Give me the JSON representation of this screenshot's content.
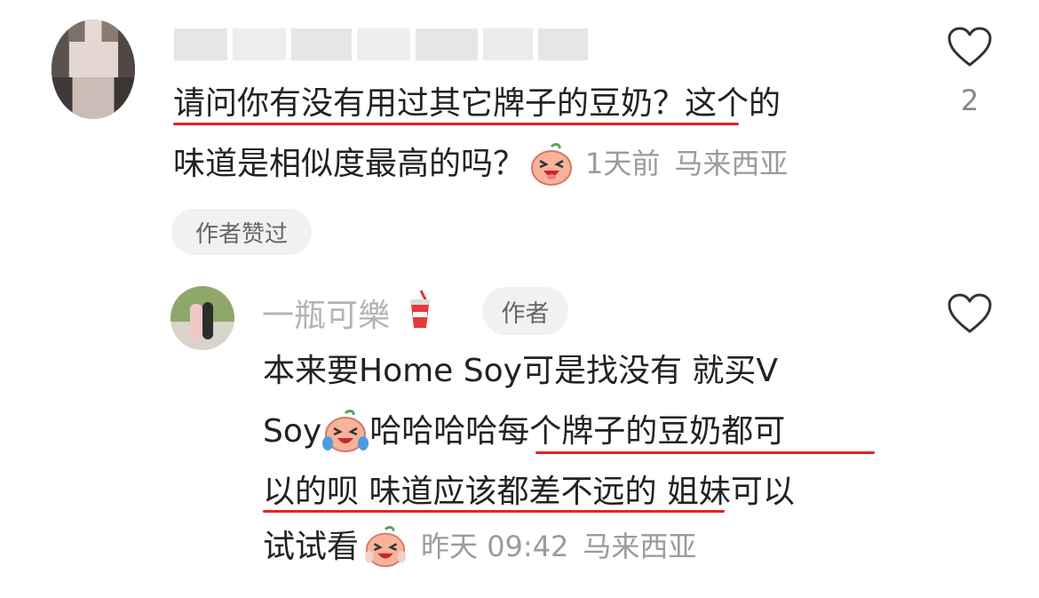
{
  "comment": {
    "text_line1": "请问你有没有用过其它牌子的豆奶？这个的",
    "text_line2": "味道是相似度最高的吗？",
    "time": "1天前",
    "location": "马来西亚",
    "like_count": "2",
    "liked_badge": "作者赞过"
  },
  "reply": {
    "username": "一瓶可樂",
    "author_badge": "作者",
    "line1": "本来要Home Soy可是找没有 就买V",
    "line2_a": "Soy",
    "line2_b": "哈哈哈哈 ",
    "line2_c": "每个牌子的豆奶都可",
    "line3_a": "以的呗 味道应该都差不远的",
    "line3_b": " 姐妹可以",
    "line4": "试试看",
    "time": "昨天 09:42",
    "location": "马来西亚"
  },
  "icons": {
    "like": "heart-outline-icon",
    "drink": "cup-drink-emoji",
    "laugh": "laughing-peach-emoji",
    "cry_laugh": "tears-of-joy-peach-emoji"
  },
  "colors": {
    "underline": "#e02424",
    "meta": "#9b9b9b"
  }
}
